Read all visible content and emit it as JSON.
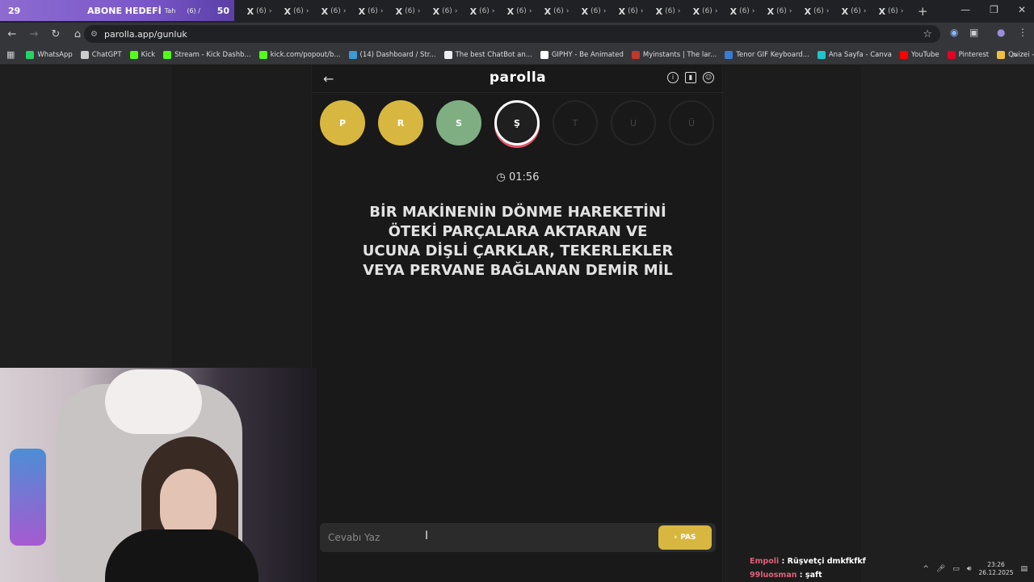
{
  "tabstrip": {
    "goal_count_left": "29",
    "goal_text": "ABONE HEDEFİ",
    "goal_tab_partial": "Tah",
    "goal_count_right": "50",
    "tabs": [
      {
        "label": "(6)"
      },
      {
        "label": "(6)"
      },
      {
        "label": "(6)"
      },
      {
        "label": "(6)"
      },
      {
        "label": "(6)"
      },
      {
        "label": "(6)"
      },
      {
        "label": "(6)"
      },
      {
        "label": "(6)"
      },
      {
        "label": "(6)"
      },
      {
        "label": "(6)"
      },
      {
        "label": "(6)"
      },
      {
        "label": "(6)"
      },
      {
        "label": "(6)"
      },
      {
        "label": "(6)"
      },
      {
        "label": "(6)"
      },
      {
        "label": "(6)"
      },
      {
        "label": "(6)"
      },
      {
        "label": "(6)"
      }
    ],
    "first_tab_partial": "(6) /"
  },
  "navbar": {
    "url": "parolla.app/gunluk"
  },
  "bookmarks": [
    {
      "label": "WhatsApp",
      "color": "#25d366"
    },
    {
      "label": "ChatGPT",
      "color": "#cccccc"
    },
    {
      "label": "Kick",
      "color": "#53fc18"
    },
    {
      "label": "Stream - Kick Dashb...",
      "color": "#53fc18"
    },
    {
      "label": "kick.com/popout/b...",
      "color": "#53fc18"
    },
    {
      "label": "(14) Dashboard / Str...",
      "color": "#3a9bd5"
    },
    {
      "label": "The best ChatBot an...",
      "color": "#eeeeee"
    },
    {
      "label": "GIPHY - Be Animated",
      "color": "#ffffff"
    },
    {
      "label": "Myinstants | The lar...",
      "color": "#c0392b"
    },
    {
      "label": "Tenor GIF Keyboard...",
      "color": "#3a7bd5"
    },
    {
      "label": "Ana Sayfa - Canva",
      "color": "#20c4cb"
    },
    {
      "label": "YouTube",
      "color": "#ff0000"
    },
    {
      "label": "Pinterest",
      "color": "#e60023"
    },
    {
      "label": "Quizei - Eğlenceli ve...",
      "color": "#f0c040"
    }
  ],
  "app": {
    "logo": "parolla",
    "letters": [
      {
        "char": "P",
        "state": "yellow"
      },
      {
        "char": "R",
        "state": "yellow"
      },
      {
        "char": "S",
        "state": "green"
      },
      {
        "char": "Ş",
        "state": "active"
      },
      {
        "char": "T",
        "state": "dim"
      },
      {
        "char": "U",
        "state": "dim"
      },
      {
        "char": "Ü",
        "state": "dim"
      }
    ],
    "timer": "01:56",
    "clue_lines": [
      "BİR MAKİNENİN DÖNME HAREKETİNİ",
      "ÖTEKİ PARÇALARA AKTARAN VE",
      "UCUNA DİŞLİ ÇARKLAR, TEKERLEKLER",
      "VEYA PERVANE BAĞLANAN DEMİR MİL"
    ],
    "answer_placeholder": "Cevabı Yaz",
    "pass_label": "PAS"
  },
  "chat": [
    {
      "user": "Empoli",
      "message": "Rüşvetçi dmkfkfkf"
    },
    {
      "user": "99luosman",
      "message": "şaft"
    }
  ],
  "taskbar": {
    "time": "23:26",
    "date": "26.12.2025"
  },
  "colors": {
    "yellow": "#d8b740",
    "green": "#7fae82",
    "active_ring": "#e05565"
  }
}
